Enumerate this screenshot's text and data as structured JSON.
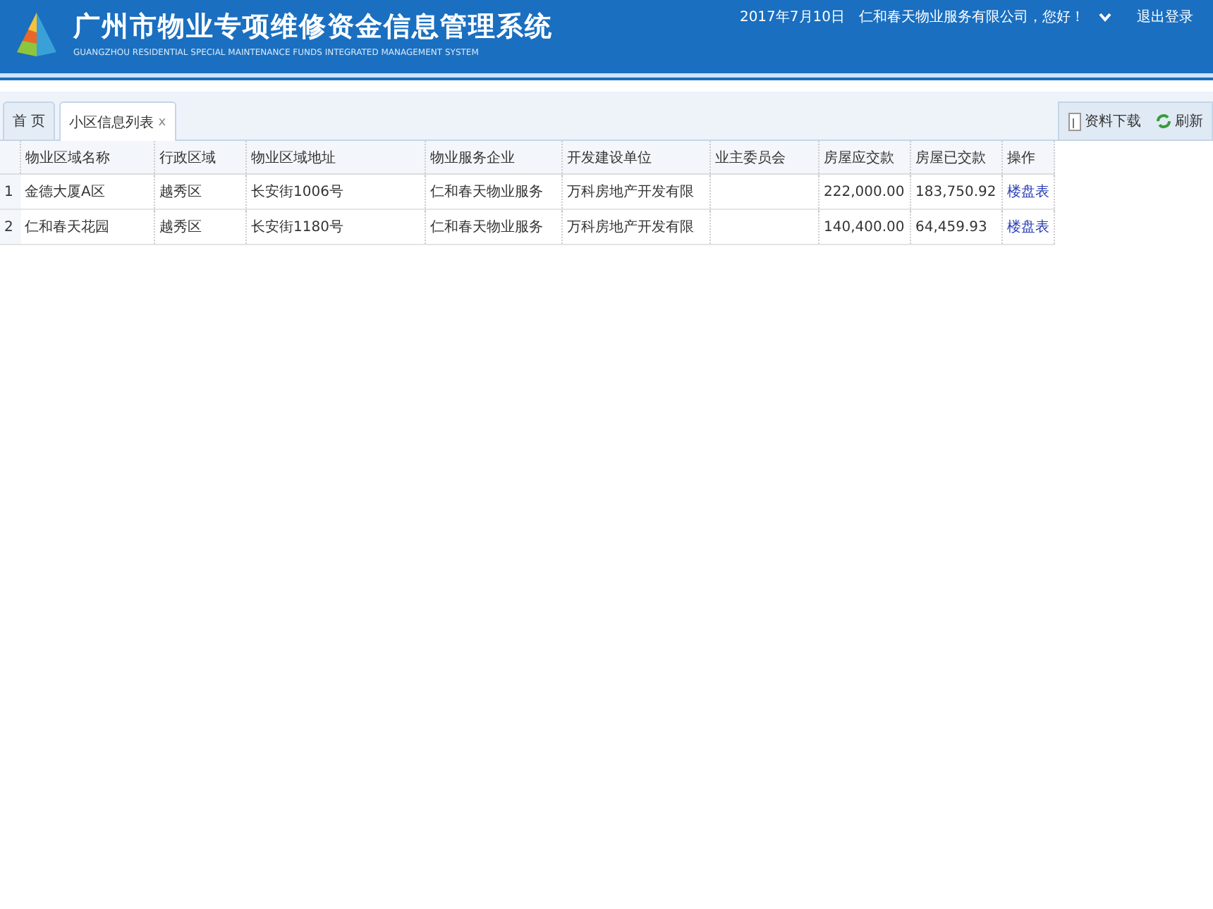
{
  "header": {
    "title": "广州市物业专项维修资金信息管理系统",
    "subtitle": "GUANGZHOU RESIDENTIAL SPECIAL MAINTENANCE FUNDS INTEGRATED MANAGEMENT SYSTEM",
    "date": "2017年7月10日",
    "greeting": "仁和春天物业服务有限公司，您好！",
    "logout": "退出登录"
  },
  "tabs": [
    {
      "label": "首 页",
      "selected": false
    },
    {
      "label": "小区信息列表",
      "selected": true,
      "close": "x"
    }
  ],
  "toolbar": [
    {
      "label": "资料下载",
      "kind": "download"
    },
    {
      "label": "刷新",
      "kind": "refresh"
    }
  ],
  "table": {
    "columns": [
      "物业区域名称",
      "行政区域",
      "物业区域地址",
      "物业服务企业",
      "开发建设单位",
      "业主委员会",
      "房屋应交款",
      "房屋已交款",
      "操作"
    ],
    "rows": [
      {
        "index": "1",
        "cells": [
          "金德大厦A区",
          "越秀区",
          "长安街1006号",
          "仁和春天物业服务",
          "万科房地产开发有限",
          "",
          "222,000.00",
          "183,750.92"
        ],
        "action": "楼盘表"
      },
      {
        "index": "2",
        "cells": [
          "仁和春天花园",
          "越秀区",
          "长安街1180号",
          "仁和春天物业服务",
          "万科房地产开发有限",
          "",
          "140,400.00",
          "64,459.93"
        ],
        "action": "楼盘表"
      }
    ]
  }
}
